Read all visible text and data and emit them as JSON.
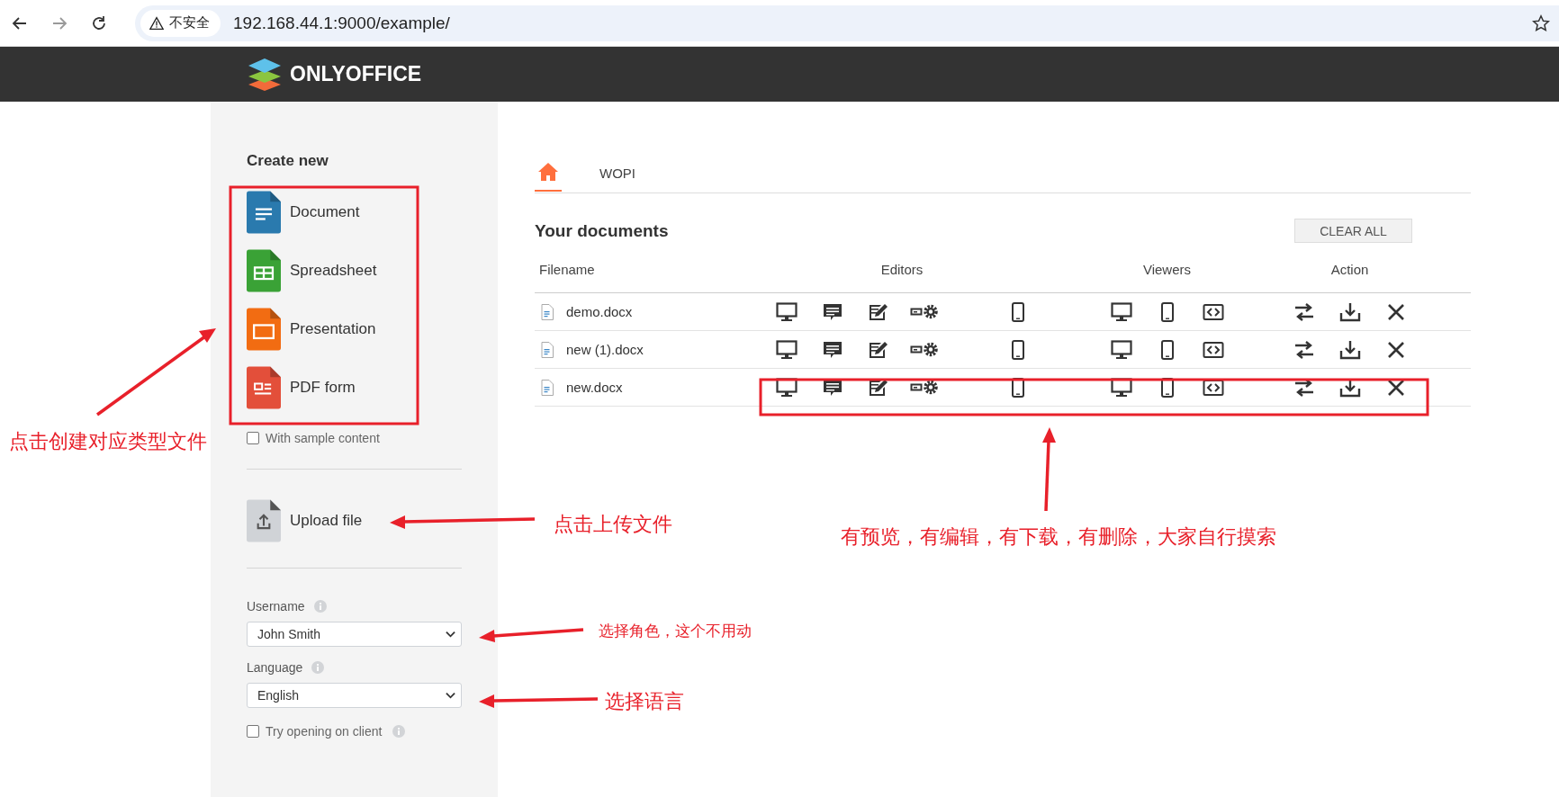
{
  "browser": {
    "security_label": "不安全",
    "url": "192.168.44.1:9000/example/"
  },
  "header": {
    "brand": "ONLYOFFICE"
  },
  "sidebar": {
    "create_title": "Create new",
    "create_items": [
      {
        "kind": "document",
        "label": "Document"
      },
      {
        "kind": "spreadsheet",
        "label": "Spreadsheet"
      },
      {
        "kind": "presentation",
        "label": "Presentation"
      },
      {
        "kind": "pdf",
        "label": "PDF form"
      }
    ],
    "sample_content": {
      "label": "With sample content",
      "checked": false
    },
    "upload": {
      "label": "Upload file"
    },
    "username": {
      "label": "Username",
      "value": "John Smith"
    },
    "language": {
      "label": "Language",
      "value": "English"
    },
    "try_client": {
      "label": "Try opening on client",
      "checked": false
    }
  },
  "tabs": [
    {
      "kind": "home",
      "selected": true
    },
    {
      "kind": "text",
      "label": "WOPI",
      "selected": false
    }
  ],
  "documents": {
    "title": "Your documents",
    "clear_button": "CLEAR ALL",
    "columns": [
      "Filename",
      "Editors",
      "Viewers",
      "Action"
    ],
    "rows": [
      {
        "filename": "demo.docx"
      },
      {
        "filename": "new (1).docx"
      },
      {
        "filename": "new.docx"
      }
    ]
  },
  "annotations": [
    {
      "text": "点击创建对应类型文件"
    },
    {
      "text": "点击上传文件"
    },
    {
      "text": "有预览，有编辑，有下载，有删除，大家自行摸索"
    },
    {
      "text": "选择角色，这个不用动"
    },
    {
      "text": "选择语言"
    }
  ]
}
